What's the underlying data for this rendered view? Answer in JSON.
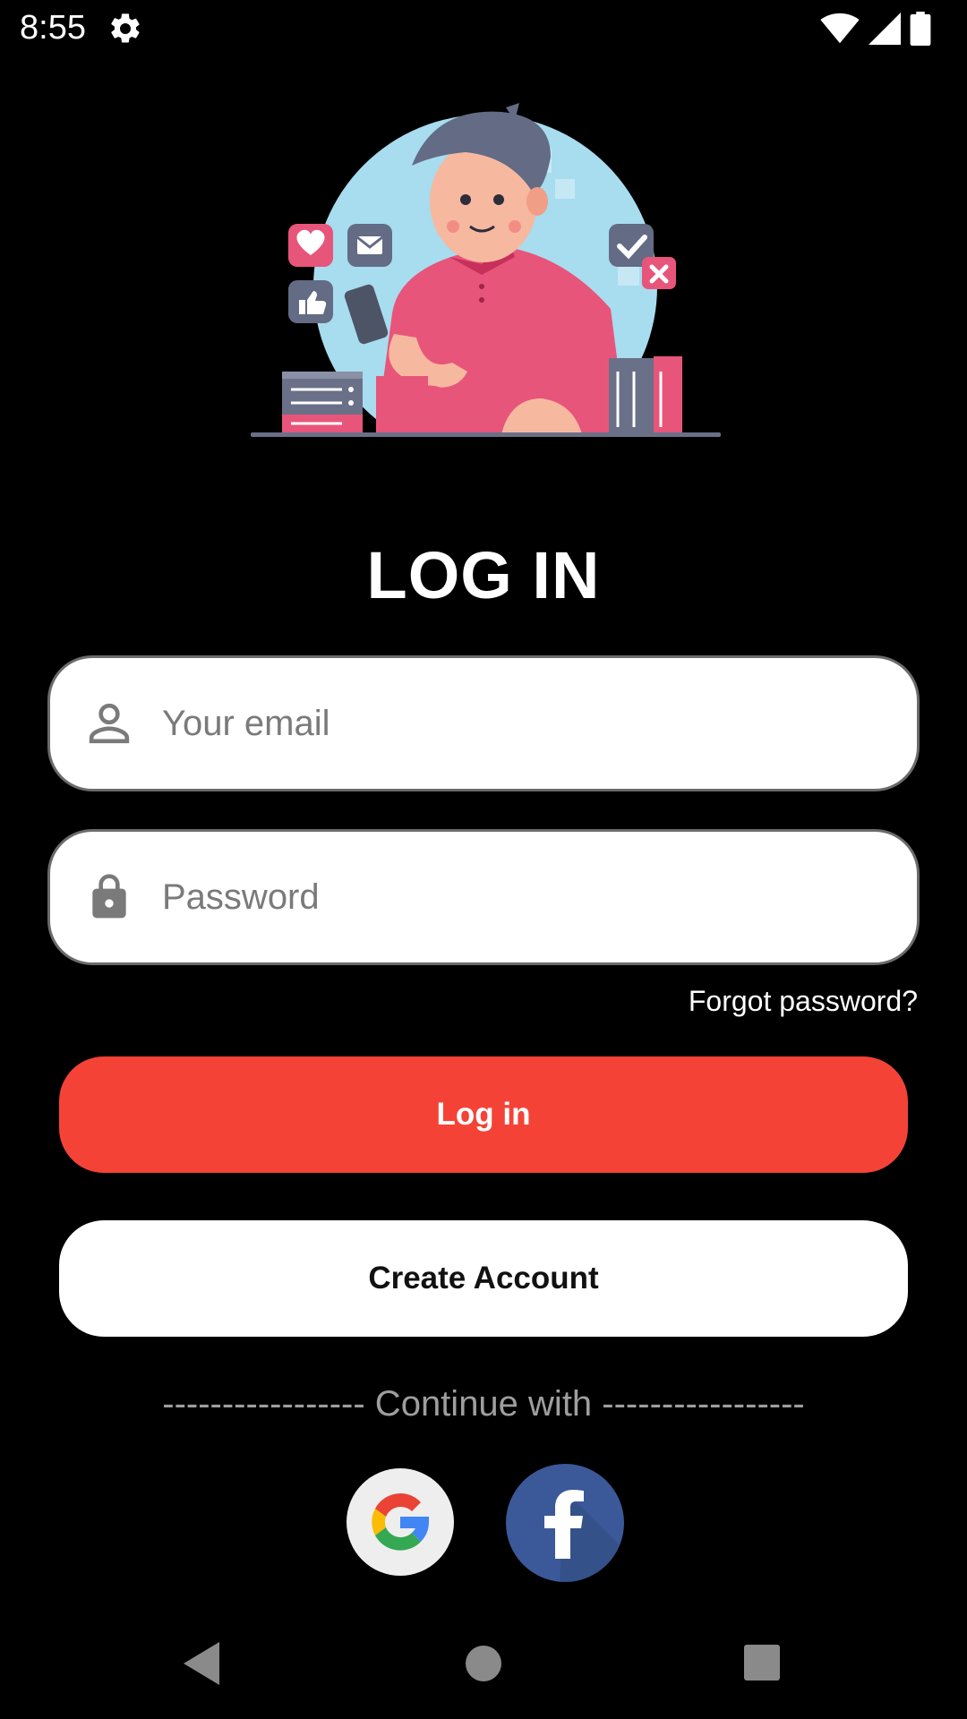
{
  "status_bar": {
    "time": "8:55",
    "left_icons": [
      "gear-icon"
    ],
    "right_icons": [
      "wifi-icon",
      "cell-signal-icon",
      "battery-icon"
    ]
  },
  "illustration": "person-with-phone-social-media-illustration",
  "title": "LOG IN",
  "email": {
    "placeholder": "Your email",
    "value": "",
    "icon": "person-icon"
  },
  "password": {
    "placeholder": "Password",
    "value": "",
    "icon": "lock-icon"
  },
  "forgot_password": "Forgot password?",
  "login_button": "Log in",
  "create_account_button": "Create Account",
  "continue_with": "----------------- Continue with -----------------",
  "social": [
    {
      "name": "google",
      "icon": "google-icon"
    },
    {
      "name": "facebook",
      "icon": "facebook-icon"
    }
  ],
  "colors": {
    "background": "#000000",
    "primary": "#f44336",
    "field_background": "#ffffff",
    "muted_text": "#9e9e9e",
    "facebook": "#3b5998"
  },
  "nav_bar": {
    "icons": [
      "back-icon",
      "home-icon",
      "recents-icon"
    ]
  }
}
